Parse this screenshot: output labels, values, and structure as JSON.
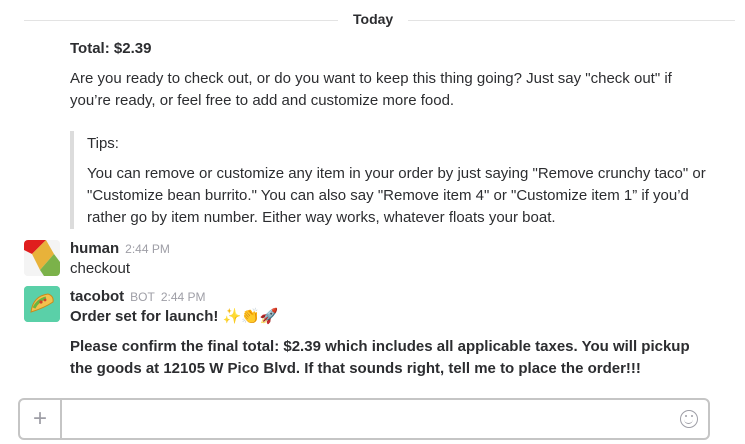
{
  "divider": {
    "label": "Today"
  },
  "continuation": {
    "total": "Total: $2.39",
    "prompt": "Are you ready to check out, or do you want to keep this thing going? Just say \"check out\" if you’re ready, or feel free to add and customize more food.",
    "tips": {
      "title": "Tips:",
      "text": "You can remove or customize any item in your order by just saying \"Remove crunchy taco\" or \"Customize bean burrito.\" You can also say \"Remove item 4\" or \"Customize item 1” if you’d rather go by item number. Either way works, whatever floats your boat."
    }
  },
  "messages": [
    {
      "author": "human",
      "time": "2:44 PM",
      "text": "checkout"
    },
    {
      "author": "tacobot",
      "badge": "BOT",
      "time": "2:44 PM",
      "launch": "Order set for launch!",
      "emoji": "✨👏🚀",
      "confirm": "Please confirm the final total: $2.39 which includes all applicable taxes. You will pickup the goods at 12105 W Pico Blvd. If that sounds right, tell me to place the order!!!"
    }
  ],
  "composer": {
    "value": "",
    "plus": "+"
  },
  "colors": {
    "text": "#2c2d30",
    "meta": "#9e9ea6",
    "tacobot_avatar": "#5ad0a8"
  }
}
